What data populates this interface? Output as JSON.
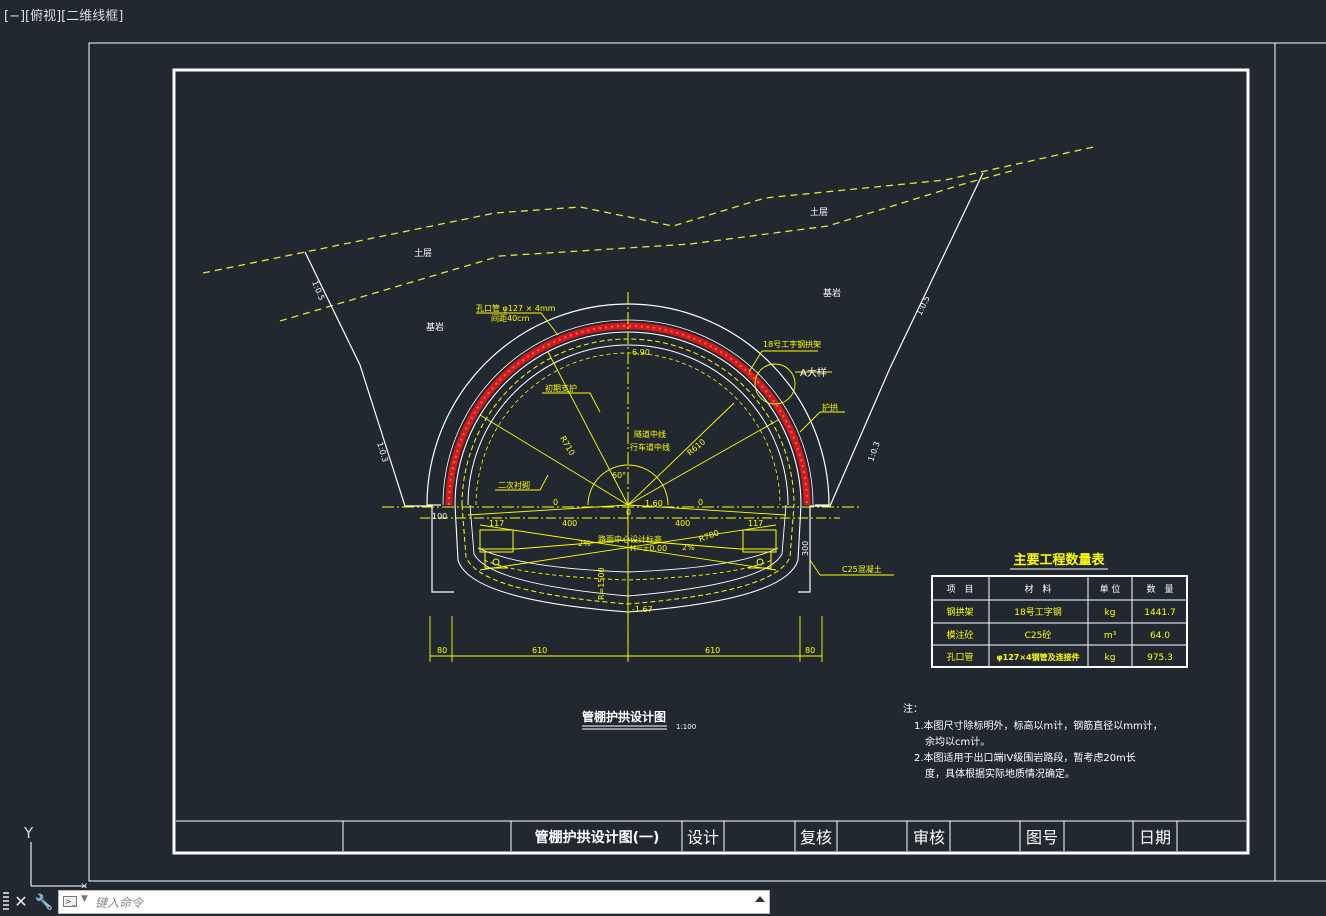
{
  "viewport": {
    "label": "[−][俯视][二维线框]"
  },
  "drawing": {
    "layers": {
      "soil_upper": "土层",
      "soil_lower": "土层",
      "bedrock_left": "基岩",
      "bedrock_right": "基岩"
    },
    "slopes": {
      "upper_left": "1:0.5",
      "upper_right": "1:0.5",
      "lower_left": "1:0.3",
      "lower_right": "1:0.3"
    },
    "callouts": {
      "pipe": "孔口管 φ127 × 4mm",
      "spacing": "间距40cm",
      "steel_arch": "18号工字钢拱架",
      "detail_a": "A大样",
      "guard_arch": "护拱",
      "primary_support": "初期支护",
      "secondary_lining": "二次衬砌",
      "tunnel_center": "隧道中线",
      "lane_center": "行车道中线",
      "road_design_elev": "路面中心设计标高",
      "elev_zero": "H=±0.00",
      "concrete": "C25混凝土"
    },
    "dimensions": {
      "top_elev": "6.90",
      "mid_elev": "1.60",
      "bottom_elev": "-1.67",
      "r1": "R710",
      "r2": "R610",
      "r3": "R780",
      "r4": "R=1500",
      "angle": "60°",
      "slope_pct_left": "2%",
      "slope_pct_right": "2%",
      "w117_left": "117",
      "w400_left": "400",
      "w400_right": "400",
      "w117_right": "117",
      "w100": "100",
      "w300": "300",
      "w80_left": "80",
      "w610_left": "610",
      "w610_right": "610",
      "w80_right": "80",
      "zero_left": "0",
      "zero_mid": "0",
      "zero_right": "0"
    },
    "title": "管棚护拱设计图",
    "scale": "1:100"
  },
  "quantity_table": {
    "title": "主要工程数量表",
    "headers": [
      "项　目",
      "材　料",
      "单 位",
      "数　量"
    ],
    "rows": [
      [
        "钢拱架",
        "18号工字钢",
        "kg",
        "1441.7"
      ],
      [
        "模注砼",
        "C25砼",
        "m³",
        "64.0"
      ],
      [
        "孔口管",
        "φ127×4钢管及连接件",
        "kg",
        "975.3"
      ]
    ]
  },
  "notes": {
    "heading": "注：",
    "line1": "1.本图尺寸除标明外，标高以m计，钢筋直径以mm计，",
    "line2": "余均以cm计。",
    "line3": "2.本图适用于出口端IV级围岩路段，暂考虑20m长",
    "line4": "度，具体根据实际地质情况确定。"
  },
  "title_block": {
    "drawing_name": "管棚护拱设计图(一)",
    "design": "设计",
    "review": "复核",
    "approve": "审核",
    "drawing_no": "图号",
    "date": "日期"
  },
  "ucs": {
    "y_label": "Y"
  },
  "command_line": {
    "placeholder": "键入命令"
  },
  "colors": {
    "background": "#212830",
    "line_white": "#ffffff",
    "line_yellow": "#ffff00",
    "hatch_red": "#d11a1a"
  }
}
